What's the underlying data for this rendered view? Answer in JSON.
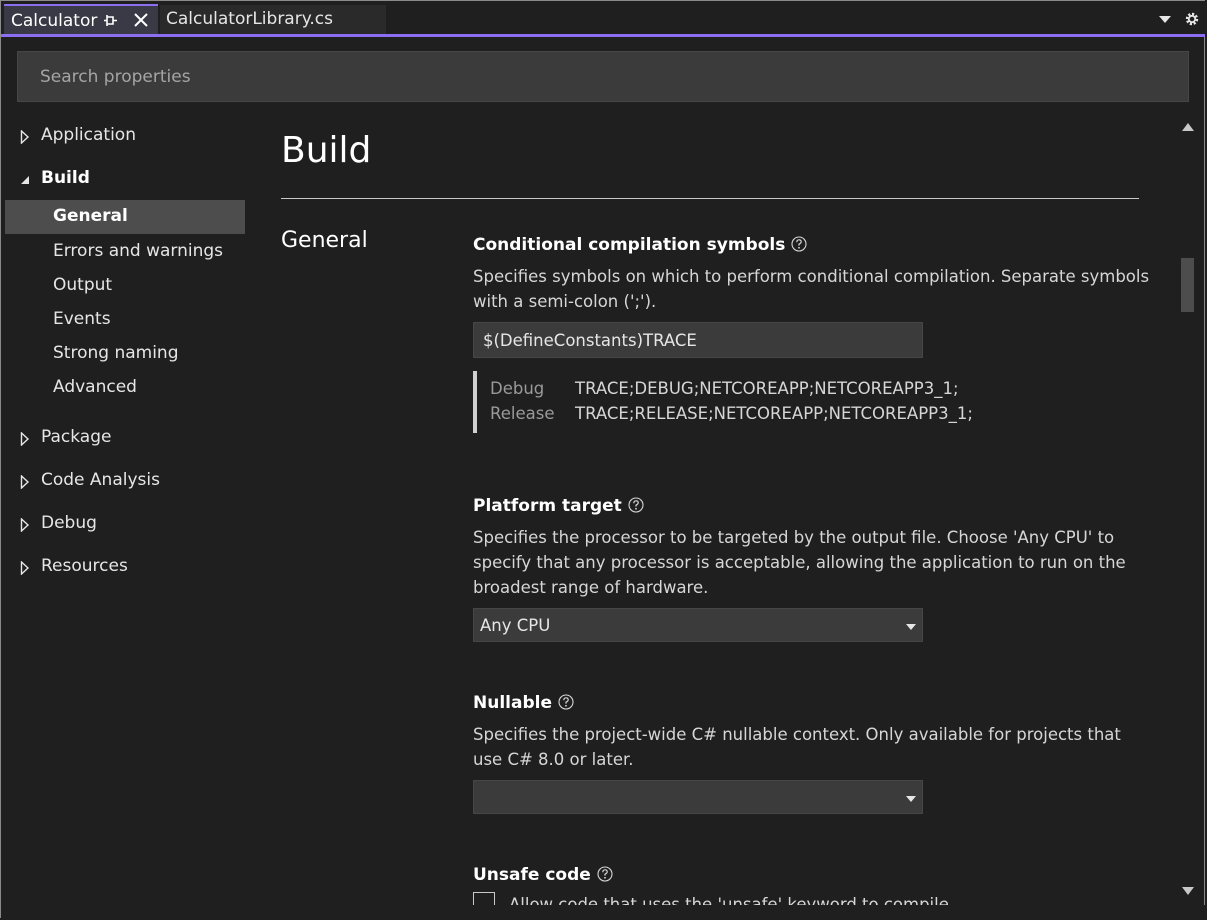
{
  "tabs": [
    {
      "label": "Calculator",
      "active": true
    },
    {
      "label": "CalculatorLibrary.cs",
      "active": false
    }
  ],
  "search": {
    "placeholder": "Search properties"
  },
  "sidebar": {
    "groups": [
      {
        "label": "Application",
        "expanded": false
      },
      {
        "label": "Build",
        "expanded": true,
        "items": [
          "General",
          "Errors and warnings",
          "Output",
          "Events",
          "Strong naming",
          "Advanced"
        ],
        "selected": "General"
      },
      {
        "label": "Package",
        "expanded": false
      },
      {
        "label": "Code Analysis",
        "expanded": false
      },
      {
        "label": "Debug",
        "expanded": false
      },
      {
        "label": "Resources",
        "expanded": false
      }
    ]
  },
  "main": {
    "page_title": "Build",
    "section_label": "General",
    "conditional": {
      "title": "Conditional compilation symbols",
      "description": "Specifies symbols on which to perform conditional compilation. Separate symbols with a semi-colon (';').",
      "value": "$(DefineConstants)TRACE",
      "evaluated": [
        {
          "config": "Debug",
          "value": "TRACE;DEBUG;NETCOREAPP;NETCOREAPP3_1;"
        },
        {
          "config": "Release",
          "value": "TRACE;RELEASE;NETCOREAPP;NETCOREAPP3_1;"
        }
      ]
    },
    "platform": {
      "title": "Platform target",
      "description": "Specifies the processor to be targeted by the output file. Choose 'Any CPU' to specify that any processor is acceptable, allowing the application to run on the broadest range of hardware.",
      "value": "Any CPU"
    },
    "nullable": {
      "title": "Nullable",
      "description": "Specifies the project-wide C# nullable context. Only available for projects that use C# 8.0 or later.",
      "value": ""
    },
    "unsafe": {
      "title": "Unsafe code",
      "checkbox_label": "Allow code that uses the 'unsafe' keyword to compile.",
      "checked": false
    }
  },
  "colors": {
    "accent": "#8c6ff0",
    "background": "#1f1f1f",
    "selected": "#4d4d4d"
  }
}
